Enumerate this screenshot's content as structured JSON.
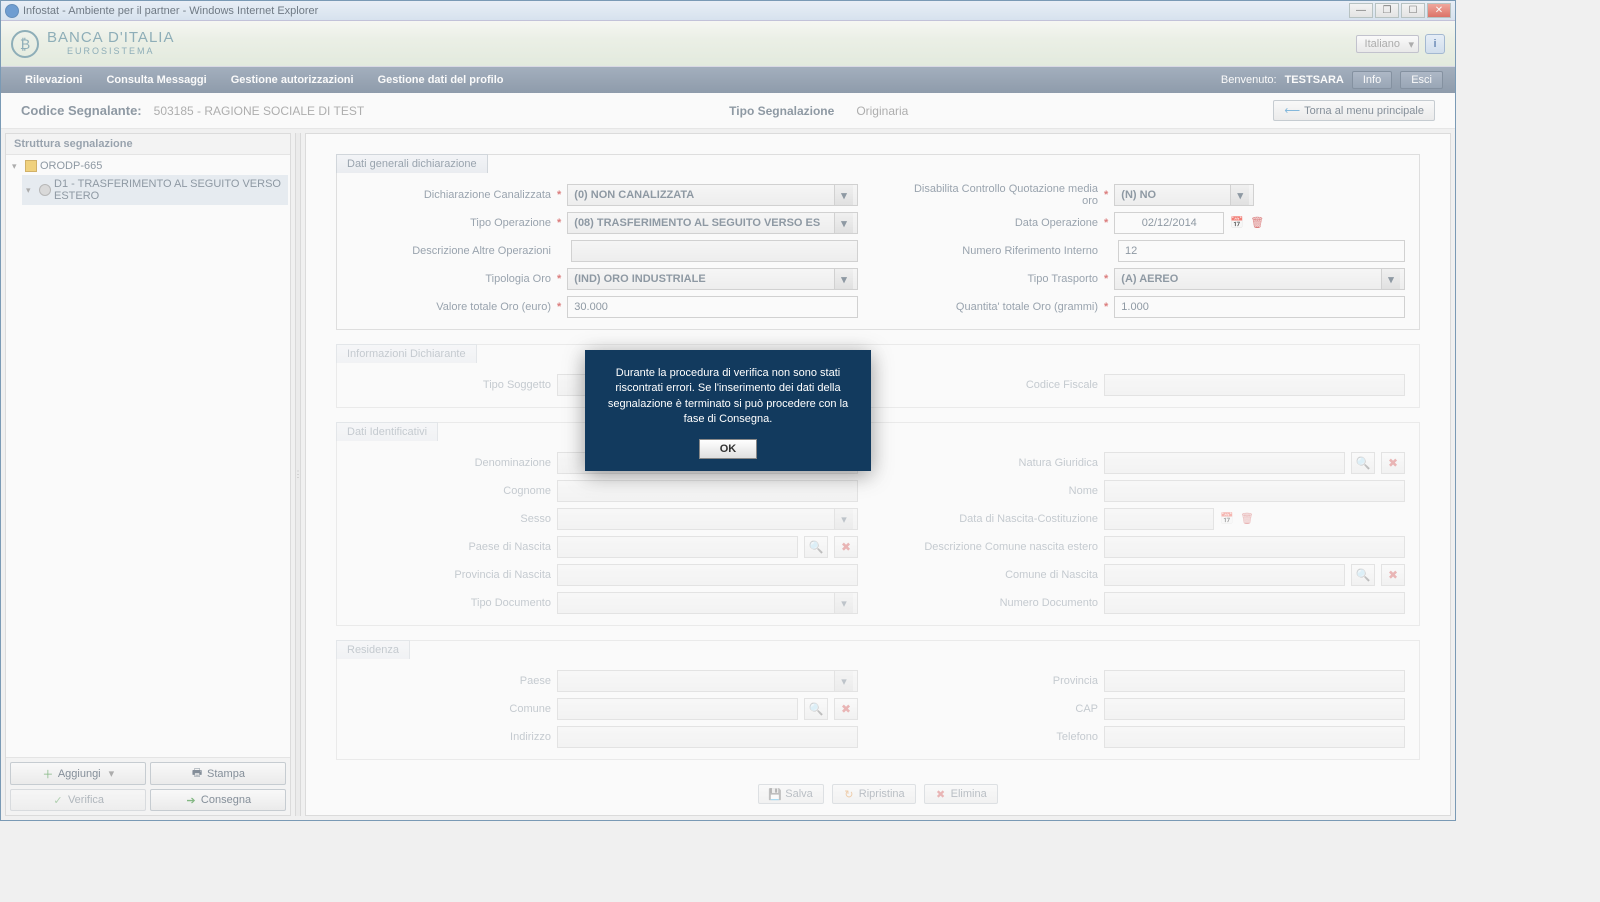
{
  "window": {
    "title": "Infostat - Ambiente per il partner - Windows Internet Explorer"
  },
  "brand": {
    "name": "BANCA D'ITALIA",
    "sub": "EUROSISTEMA",
    "language": "Italiano"
  },
  "nav": {
    "items": [
      "Rilevazioni",
      "Consulta Messaggi",
      "Gestione autorizzazioni",
      "Gestione dati del profilo"
    ],
    "welcome_label": "Benvenuto:",
    "welcome_user": "TESTSARA",
    "info_btn": "Info",
    "exit_btn": "Esci"
  },
  "subheader": {
    "codice_label": "Codice Segnalante:",
    "codice_value": "503185 - RAGIONE SOCIALE DI TEST",
    "tipo_label": "Tipo Segnalazione",
    "tipo_value": "Originaria",
    "return_btn": "Torna al menu principale"
  },
  "sidebar": {
    "title": "Struttura segnalazione",
    "root": "ORODP-665",
    "child": "D1 - TRASFERIMENTO AL SEGUITO VERSO ESTERO",
    "btn_aggiungi": "Aggiungi",
    "btn_stampa": "Stampa",
    "btn_verifica": "Verifica",
    "btn_consegna": "Consegna"
  },
  "panel1": {
    "tab": "Dati generali dichiarazione",
    "dich_canal_label": "Dichiarazione Canalizzata",
    "dich_canal_value": "(0) NON CANALIZZATA",
    "tipo_op_label": "Tipo Operazione",
    "tipo_op_value": "(08) TRASFERIMENTO AL SEGUITO VERSO ES",
    "descr_altre_label": "Descrizione Altre Operazioni",
    "descr_altre_value": "",
    "tipologia_oro_label": "Tipologia Oro",
    "tipologia_oro_value": "(IND) ORO INDUSTRIALE",
    "valore_label": "Valore totale Oro (euro)",
    "valore_value": "30.000",
    "disab_label": "Disabilita Controllo Quotazione media oro",
    "disab_value": "(N) NO",
    "data_op_label": "Data Operazione",
    "data_op_value": "02/12/2014",
    "num_rif_label": "Numero Riferimento Interno",
    "num_rif_value": "12",
    "tipo_trasp_label": "Tipo Trasporto",
    "tipo_trasp_value": "(A) AEREO",
    "quant_label": "Quantita' totale Oro (grammi)",
    "quant_value": "1.000"
  },
  "panel2": {
    "tab": "Informazioni Dichiarante",
    "tipo_sogg_label": "Tipo Soggetto",
    "codice_fiscale_label": "Codice Fiscale"
  },
  "panel3": {
    "tab": "Dati Identificativi",
    "denom_label": "Denominazione",
    "natura_label": "Natura Giuridica",
    "cognome_label": "Cognome",
    "nome_label": "Nome",
    "sesso_label": "Sesso",
    "data_nasc_label": "Data di Nascita-Costituzione",
    "paese_nasc_label": "Paese di Nascita",
    "descr_com_label": "Descrizione Comune nascita estero",
    "prov_nasc_label": "Provincia di Nascita",
    "com_nasc_label": "Comune di Nascita",
    "tipo_doc_label": "Tipo Documento",
    "num_doc_label": "Numero Documento"
  },
  "panel4": {
    "tab": "Residenza",
    "paese_label": "Paese",
    "provincia_label": "Provincia",
    "comune_label": "Comune",
    "cap_label": "CAP",
    "indirizzo_label": "Indirizzo",
    "telefono_label": "Telefono"
  },
  "actions": {
    "salva": "Salva",
    "ripristina": "Ripristina",
    "elimina": "Elimina"
  },
  "modal": {
    "message": "Durante la procedura di verifica non sono stati riscontrati errori. Se l'inserimento dei dati della segnalazione è terminato si può procedere con la fase di Consegna.",
    "ok": "OK"
  }
}
